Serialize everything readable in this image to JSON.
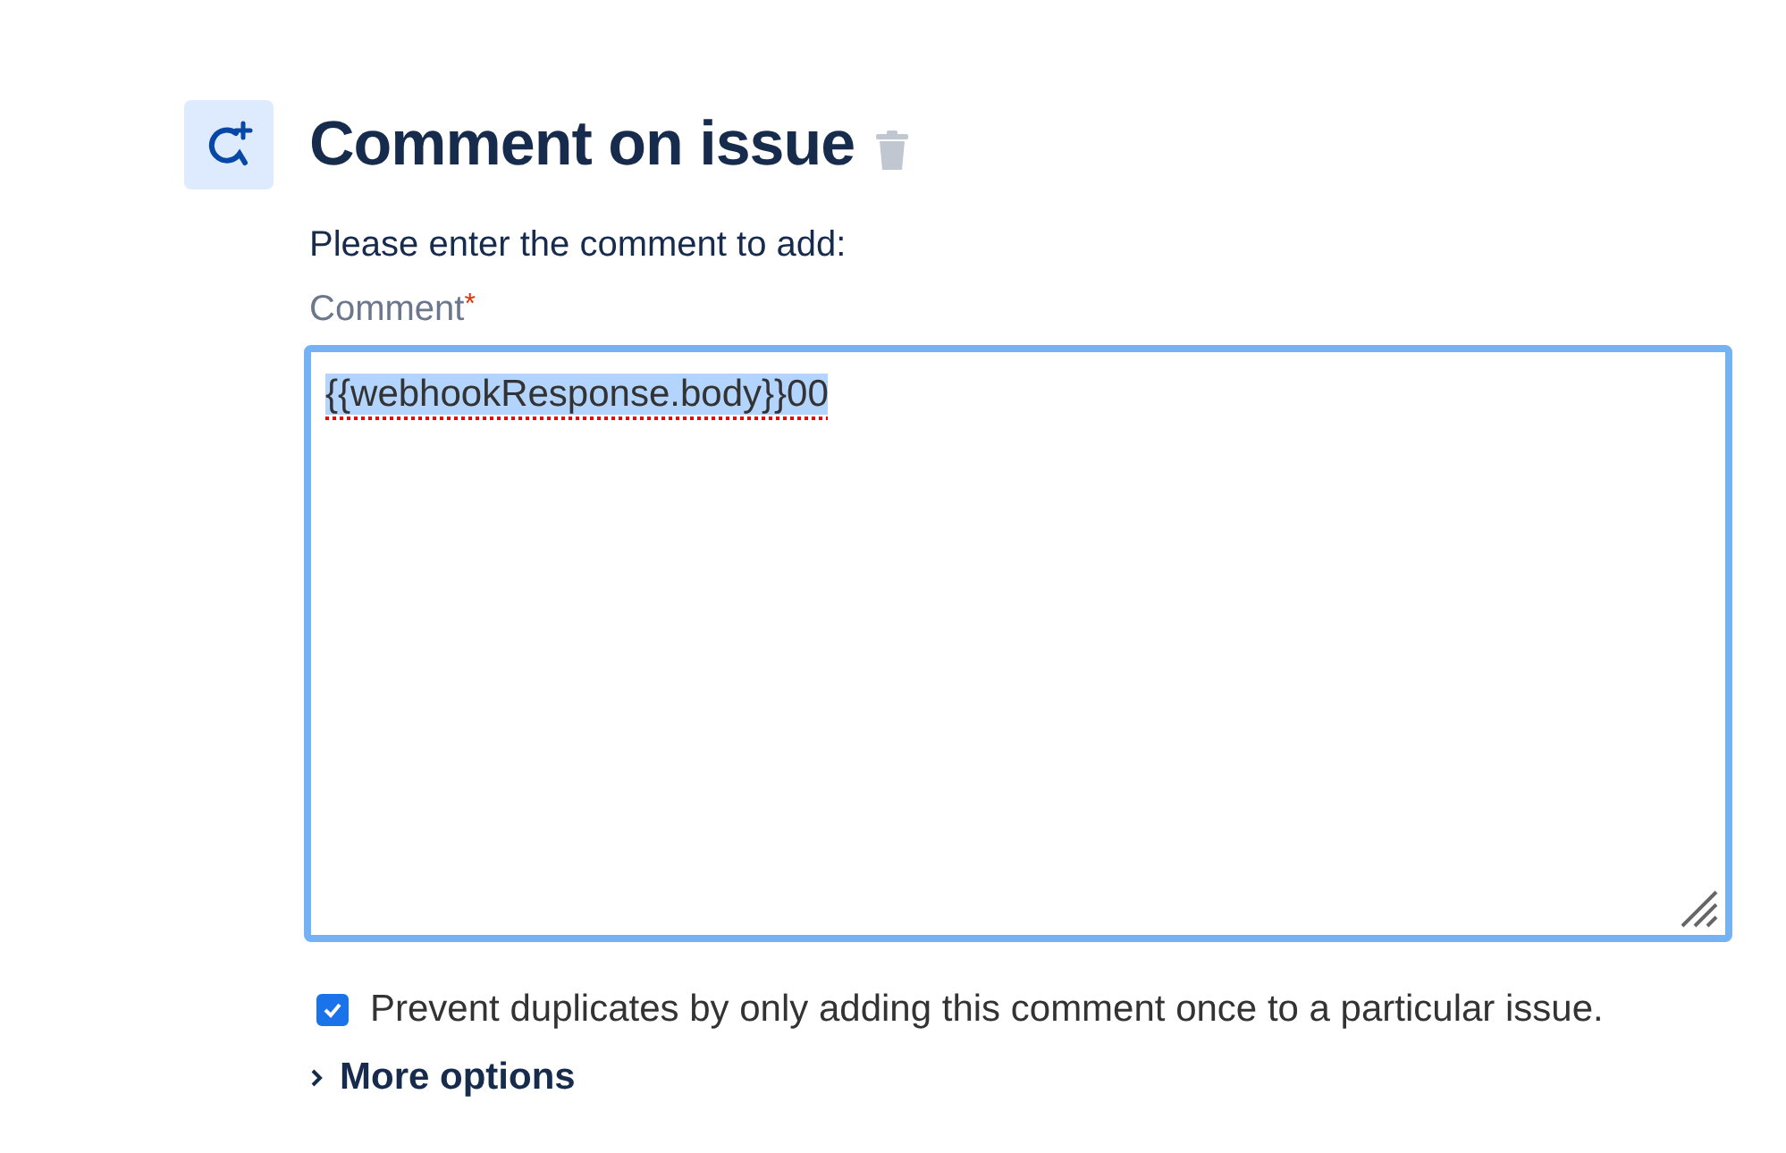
{
  "title": "Comment on issue",
  "instruction": "Please enter the comment to add:",
  "comment_field": {
    "label": "Comment",
    "required_marker": "*",
    "value": "{{webhookResponse.body}}00",
    "text_selected": true
  },
  "prevent_duplicates": {
    "label": "Prevent duplicates by only adding this comment once to a particular issue.",
    "checked": true
  },
  "more_options": {
    "label": "More options",
    "expanded": false
  }
}
